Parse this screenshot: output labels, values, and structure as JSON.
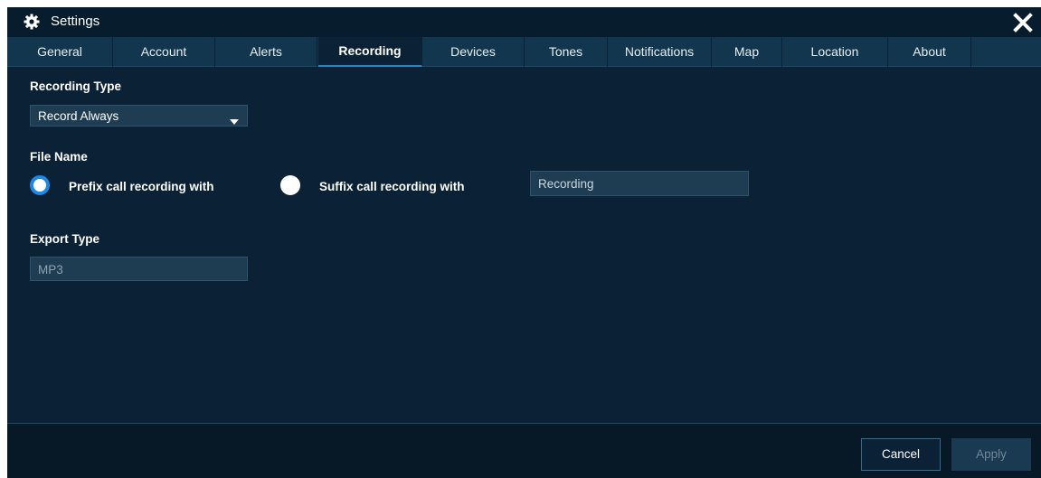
{
  "window": {
    "title": "Settings",
    "icons": {
      "settings": "gear-icon",
      "close": "close-icon"
    }
  },
  "tabs": [
    {
      "label": "General",
      "active": false
    },
    {
      "label": "Account",
      "active": false
    },
    {
      "label": "Alerts",
      "active": false
    },
    {
      "label": "Recording",
      "active": true
    },
    {
      "label": "Devices",
      "active": false
    },
    {
      "label": "Tones",
      "active": false
    },
    {
      "label": "Notifications",
      "active": false
    },
    {
      "label": "Map",
      "active": false
    },
    {
      "label": "Location",
      "active": false
    },
    {
      "label": "About",
      "active": false
    }
  ],
  "recording": {
    "type_label": "Recording Type",
    "type_value": "Record Always",
    "file_name_label": "File Name",
    "prefix_label": "Prefix call recording with",
    "suffix_label": "Suffix call recording with",
    "selected_option": "prefix",
    "file_name_value": "Recording",
    "export_label": "Export Type",
    "export_value": "MP3"
  },
  "footer": {
    "cancel_label": "Cancel",
    "apply_label": "Apply"
  },
  "colors": {
    "background": "#0b2236",
    "tab_bar": "#12364e",
    "accent": "#1e88e5",
    "input_bg": "#1f3d52"
  }
}
